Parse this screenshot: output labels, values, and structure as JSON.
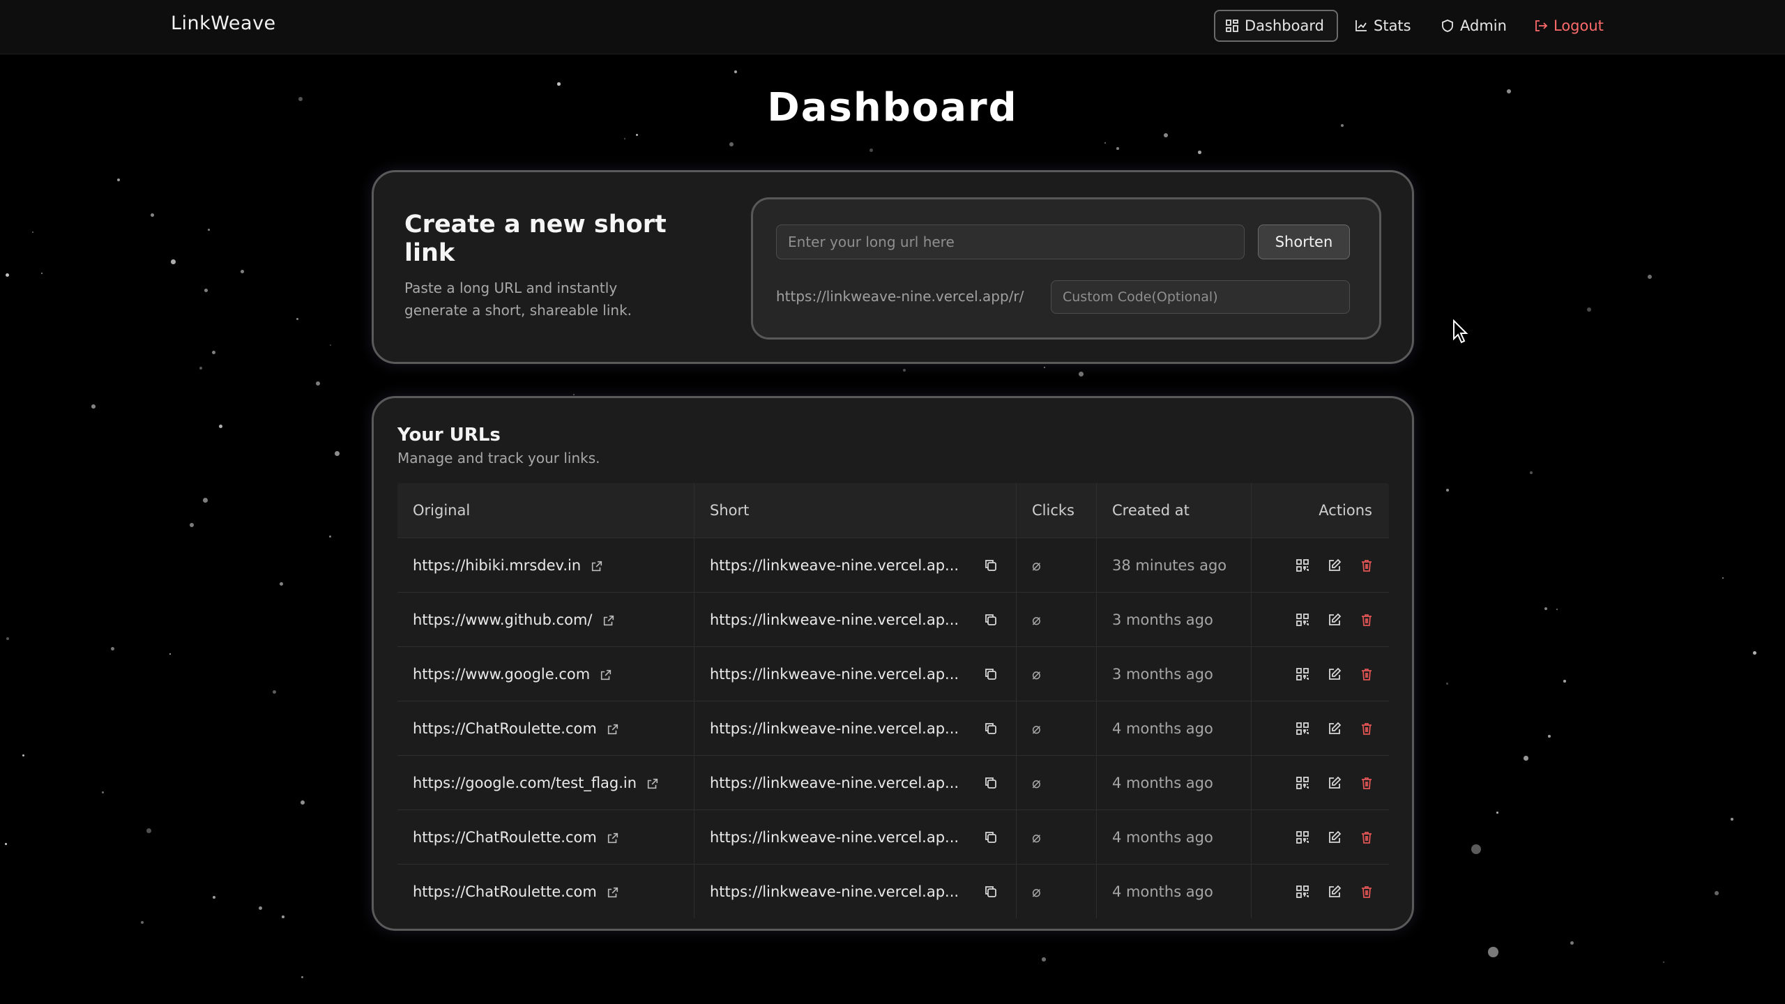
{
  "app": {
    "brand": "LinkWeave"
  },
  "nav": {
    "dashboard": "Dashboard",
    "stats": "Stats",
    "admin": "Admin",
    "logout": "Logout"
  },
  "page": {
    "title": "Dashboard"
  },
  "create": {
    "title": "Create a new short link",
    "subtitle": "Paste a long URL and instantly generate a short, shareable link.",
    "url_placeholder": "Enter your long url here",
    "shorten_label": "Shorten",
    "prefix": "https://linkweave-nine.vercel.app/r/",
    "code_placeholder": "Custom Code(Optional)"
  },
  "urls": {
    "title": "Your URLs",
    "subtitle": "Manage and track your links.",
    "columns": [
      "Original",
      "Short",
      "Clicks",
      "Created at",
      "Actions"
    ],
    "rows": [
      {
        "original": "https://hibiki.mrsdev.in",
        "short": "https://linkweave-nine.vercel.ap...",
        "clicks": "⌀",
        "created": "38 minutes ago"
      },
      {
        "original": "https://www.github.com/",
        "short": "https://linkweave-nine.vercel.ap...",
        "clicks": "⌀",
        "created": "3 months ago"
      },
      {
        "original": "https://www.google.com",
        "short": "https://linkweave-nine.vercel.ap...",
        "clicks": "⌀",
        "created": "3 months ago"
      },
      {
        "original": "https://ChatRoulette.com",
        "short": "https://linkweave-nine.vercel.ap...",
        "clicks": "⌀",
        "created": "4 months ago"
      },
      {
        "original": "https://google.com/test_flag.in",
        "short": "https://linkweave-nine.vercel.ap...",
        "clicks": "⌀",
        "created": "4 months ago"
      },
      {
        "original": "https://ChatRoulette.com",
        "short": "https://linkweave-nine.vercel.ap...",
        "clicks": "⌀",
        "created": "4 months ago"
      },
      {
        "original": "https://ChatRoulette.com",
        "short": "https://linkweave-nine.vercel.ap...",
        "clicks": "⌀",
        "created": "4 months ago"
      }
    ]
  },
  "colors": {
    "background": "#000000",
    "card": "#1c1c1c",
    "logout": "#ff6b6b",
    "delete": "#e05454"
  },
  "icons": {
    "nav_dashboard": "grid-icon",
    "nav_stats": "chart-icon",
    "nav_admin": "shield-icon",
    "nav_logout": "logout-icon",
    "external": "external-link-icon",
    "copy": "copy-icon",
    "qr": "qr-code-icon",
    "edit": "edit-icon",
    "delete": "trash-icon"
  }
}
